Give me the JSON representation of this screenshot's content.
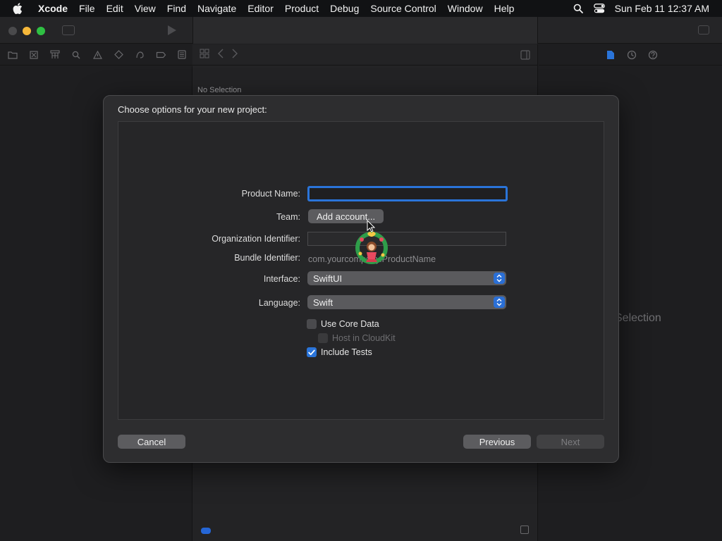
{
  "menubar": {
    "app_name": "Xcode",
    "items": [
      "File",
      "Edit",
      "View",
      "Find",
      "Navigate",
      "Editor",
      "Product",
      "Debug",
      "Source Control",
      "Window",
      "Help"
    ],
    "clock": "Sun Feb 11  12:37 AM"
  },
  "editor": {
    "no_selection": "No Selection"
  },
  "inspector": {
    "no_selection": "Selection"
  },
  "sheet": {
    "title": "Choose options for your new project:",
    "fields": {
      "product_name_label": "Product Name:",
      "product_name_value": "",
      "team_label": "Team:",
      "team_button": "Add account...",
      "org_id_label": "Organization Identifier:",
      "org_id_value": "",
      "bundle_id_label": "Bundle Identifier:",
      "bundle_id_value": "com.yourcompany.ProductName",
      "interface_label": "Interface:",
      "interface_value": "SwiftUI",
      "language_label": "Language:",
      "language_value": "Swift"
    },
    "options": {
      "use_core_data": "Use Core Data",
      "use_core_data_checked": false,
      "host_in_cloudkit": "Host in CloudKit",
      "host_in_cloudkit_checked": false,
      "include_tests": "Include Tests",
      "include_tests_checked": true
    },
    "buttons": {
      "cancel": "Cancel",
      "previous": "Previous",
      "next": "Next"
    }
  },
  "colors": {
    "accent": "#2a74d9",
    "traffic_close": "#4a4a4c",
    "traffic_minimize": "#f6b83a",
    "traffic_zoom": "#2fc043"
  }
}
